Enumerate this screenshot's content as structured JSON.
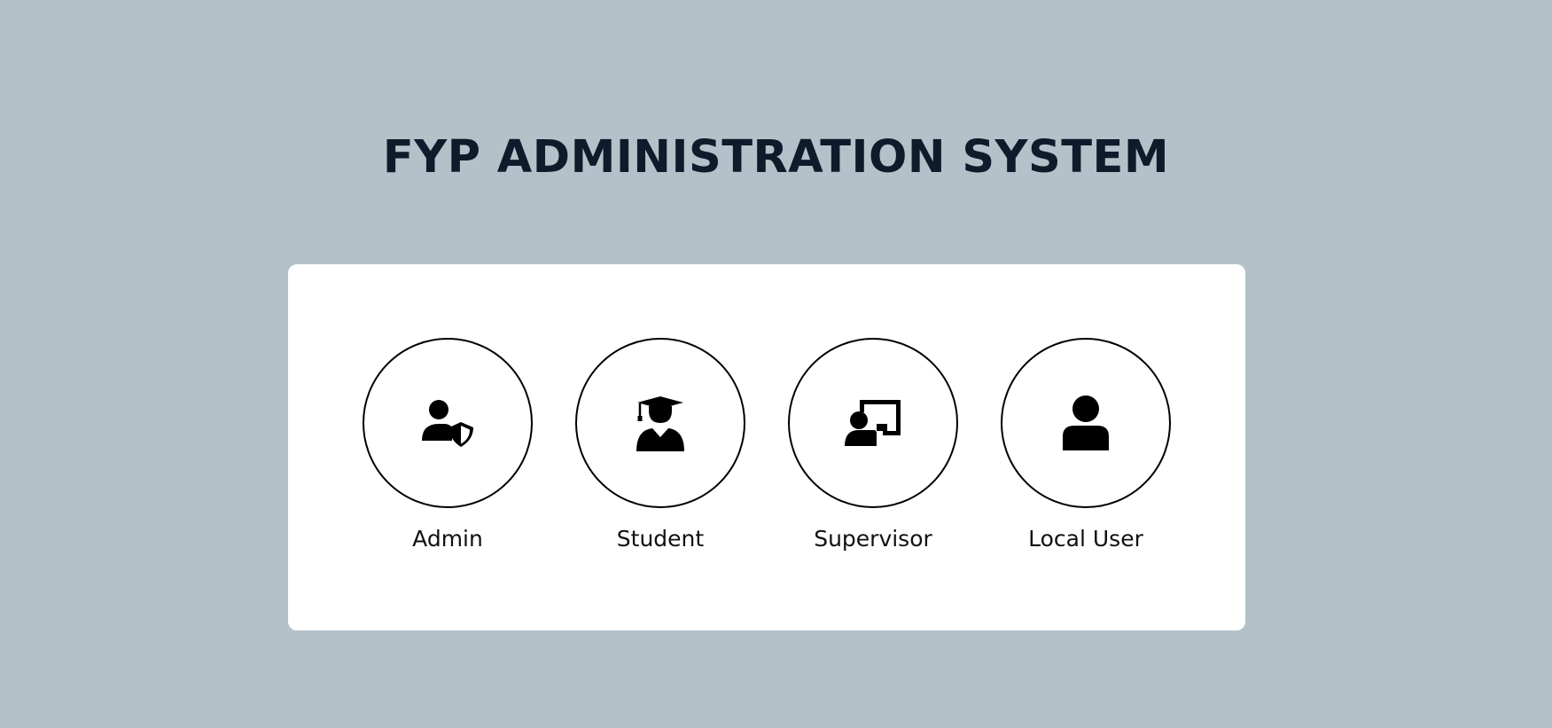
{
  "page": {
    "title": "FYP ADMINISTRATION SYSTEM"
  },
  "roles": [
    {
      "label": "Admin",
      "icon": "user-shield-icon"
    },
    {
      "label": "Student",
      "icon": "user-graduate-icon"
    },
    {
      "label": "Supervisor",
      "icon": "chalkboard-teacher-icon"
    },
    {
      "label": "Local User",
      "icon": "user-icon"
    }
  ],
  "colors": {
    "background": "#b4c1c9",
    "card": "#ffffff",
    "title": "#0f1a2b",
    "icon": "#000000"
  }
}
